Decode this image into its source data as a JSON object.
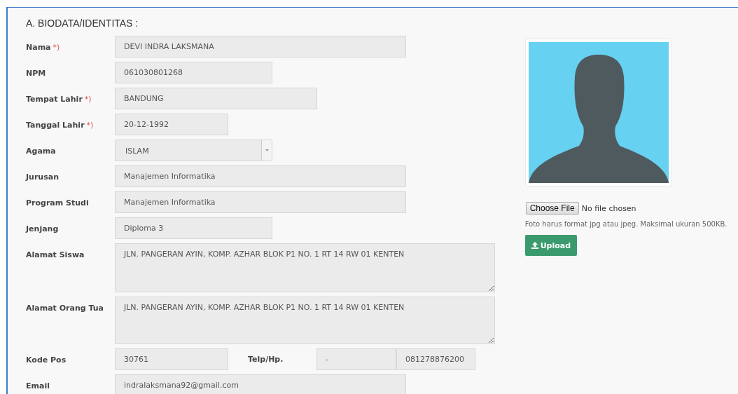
{
  "section_title": "A. BIODATA/IDENTITAS :",
  "fields": [
    {
      "kind": "text",
      "label": "Nama",
      "required_mark": "*)",
      "value": "DEVI INDRA LAKSMANA"
    },
    {
      "kind": "text",
      "label": "NPM",
      "value": "061030801268"
    },
    {
      "kind": "text",
      "label": "Tempat Lahir",
      "required_mark": "*)",
      "value": "BANDUNG"
    },
    {
      "kind": "text",
      "label": "Tanggal Lahir",
      "required_mark": "*)",
      "value": "20-12-1992"
    },
    {
      "kind": "select",
      "label": "Agama",
      "value": "ISLAM"
    },
    {
      "kind": "text",
      "label": "Jurusan",
      "value": "Manajemen Informatika"
    },
    {
      "kind": "text",
      "label": "Program Studi",
      "value": "Manajemen Informatika"
    },
    {
      "kind": "text",
      "label": "Jenjang",
      "value": "Diploma 3"
    },
    {
      "kind": "textarea",
      "label": "Alamat Siswa",
      "value": "JLN. PANGERAN AYIN, KOMP. AZHAR BLOK P1 NO. 1 RT 14 RW 01 KENTEN"
    },
    {
      "kind": "textarea",
      "label": "Alamat Orang Tua",
      "value": "JLN. PANGERAN AYIN, KOMP. AZHAR BLOK P1 NO. 1 RT 14 RW 01 KENTEN"
    },
    {
      "kind": "postal_phone",
      "label": "Kode Pos",
      "value": "30761",
      "label_2": "Telp/Hp.",
      "value_2": "-",
      "value_3": "081278876200"
    },
    {
      "kind": "text",
      "label": "Email",
      "value": "indralaksmana92@gmail.com"
    }
  ],
  "photo": {
    "choose_button": "Choose File",
    "file_status": "No file chosen",
    "hint": "Foto harus format jpg atau jpeg. Maksimal ukuran 500KB.",
    "upload_button": "Upload"
  }
}
